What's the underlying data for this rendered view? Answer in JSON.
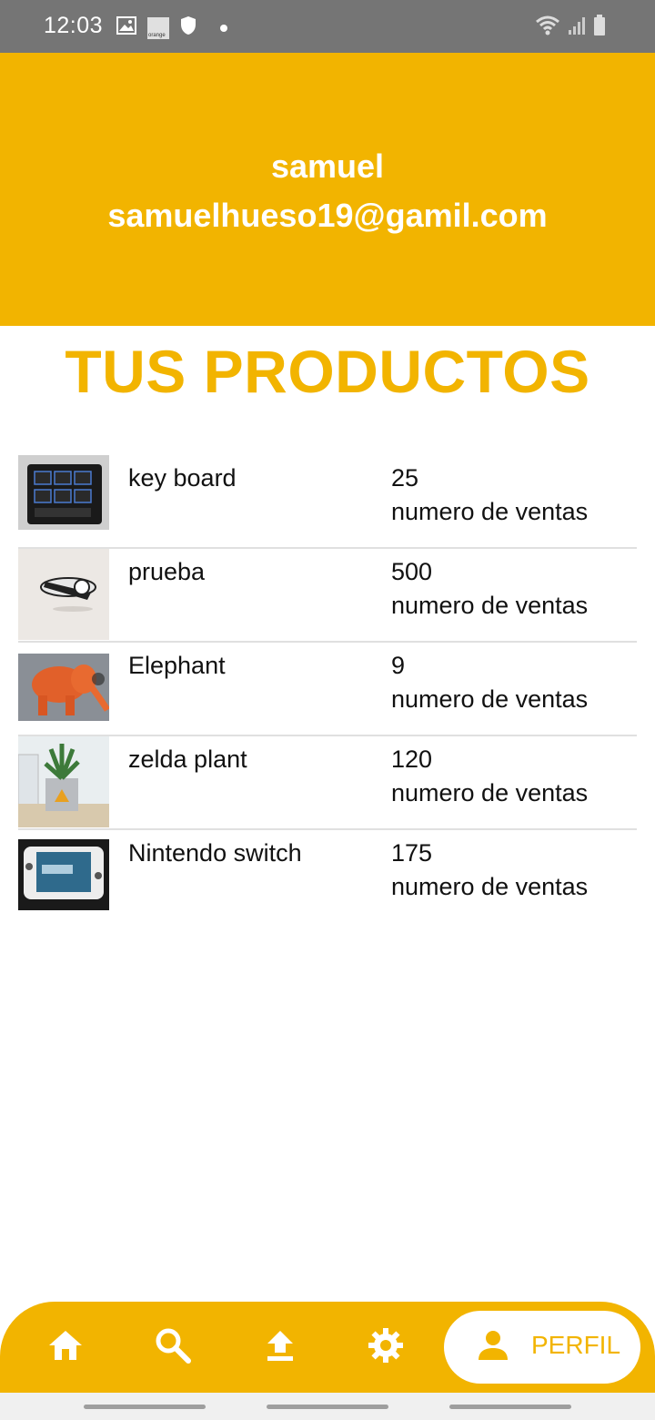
{
  "status_bar": {
    "time": "12:03",
    "left_icons": [
      "image-icon",
      "orange-carrier-icon",
      "shield-icon",
      "dot-icon"
    ],
    "right_icons": [
      "wifi-icon",
      "signal-icon",
      "battery-icon"
    ],
    "carrier_text": "orange"
  },
  "profile": {
    "name": "samuel",
    "email": "samuelhueso19@gamil.com"
  },
  "section_title": "TUS PRODUCTOS",
  "products": [
    {
      "name": "key board",
      "sales": "25",
      "sales_label": "numero de ventas"
    },
    {
      "name": "prueba",
      "sales": "500",
      "sales_label": "numero de ventas"
    },
    {
      "name": "Elephant",
      "sales": "9",
      "sales_label": "numero de ventas"
    },
    {
      "name": "zelda plant",
      "sales": "120",
      "sales_label": "numero de ventas"
    },
    {
      "name": "Nintendo switch",
      "sales": "175",
      "sales_label": "numero de ventas"
    }
  ],
  "bottom_nav": {
    "items": [
      {
        "icon": "home-icon"
      },
      {
        "icon": "search-icon"
      },
      {
        "icon": "upload-icon"
      },
      {
        "icon": "settings-icon"
      },
      {
        "icon": "person-icon",
        "label": "PERFIL",
        "active": true
      }
    ]
  },
  "colors": {
    "accent": "#f2b400",
    "status_bar": "#757575"
  }
}
